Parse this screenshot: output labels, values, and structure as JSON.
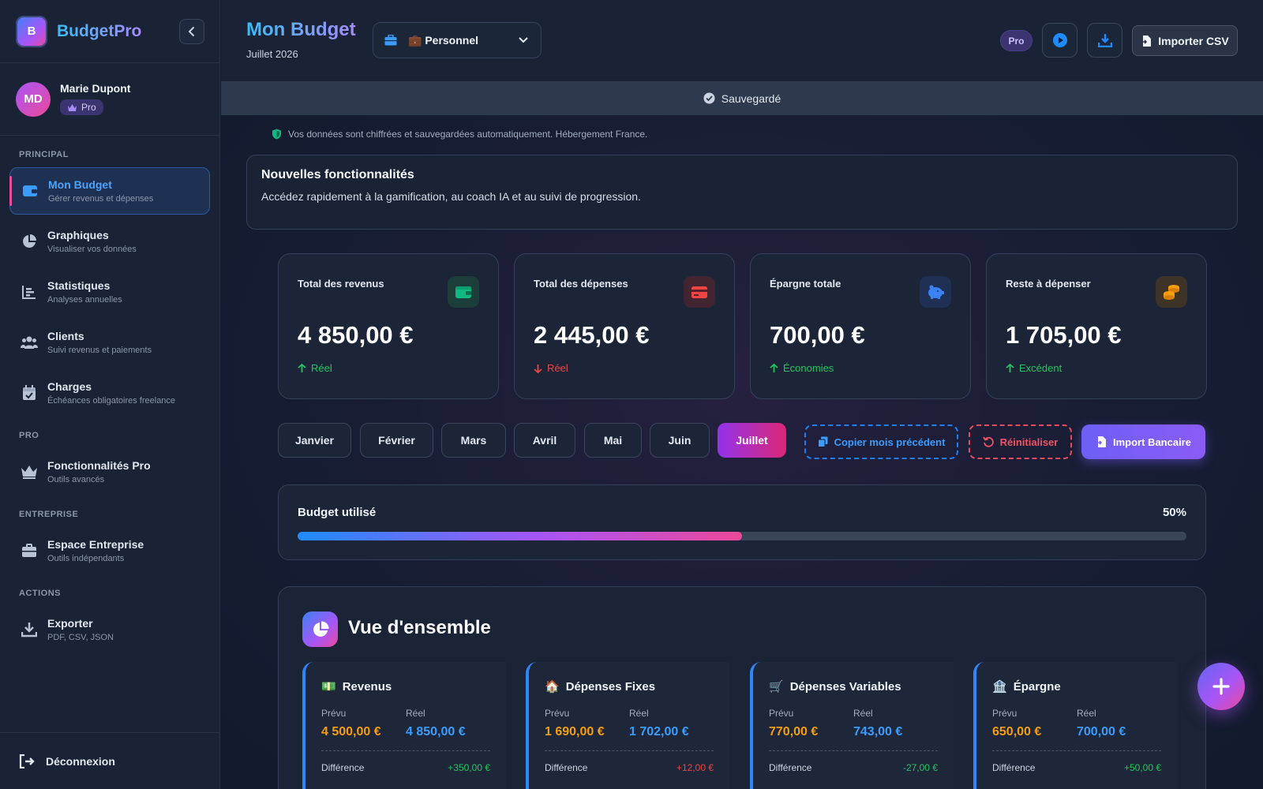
{
  "app": {
    "name": "BudgetPro",
    "logo_letter": "B"
  },
  "user": {
    "initials": "MD",
    "name": "Marie Dupont",
    "badge": "Pro"
  },
  "sidebar": {
    "sections": [
      {
        "label": "PRINCIPAL"
      },
      {
        "label": "PRO"
      },
      {
        "label": "ENTREPRISE"
      },
      {
        "label": "ACTIONS"
      }
    ],
    "items": [
      {
        "title": "Mon Budget",
        "subtitle": "Gérer revenus et dépenses",
        "icon": "wallet-icon",
        "active": true
      },
      {
        "title": "Graphiques",
        "subtitle": "Visualiser vos données",
        "icon": "pie-chart-icon"
      },
      {
        "title": "Statistiques",
        "subtitle": "Analyses annuelles",
        "icon": "bar-chart-icon"
      },
      {
        "title": "Clients",
        "subtitle": "Suivi revenus et paiements",
        "icon": "users-icon"
      },
      {
        "title": "Charges",
        "subtitle": "Échéances obligatoires freelance",
        "icon": "calendar-check-icon"
      },
      {
        "title": "Fonctionnalités Pro",
        "subtitle": "Outils avancés",
        "icon": "crown-icon"
      },
      {
        "title": "Espace Entreprise",
        "subtitle": "Outils indépendants",
        "icon": "briefcase-icon"
      },
      {
        "title": "Exporter",
        "subtitle": "PDF, CSV, JSON",
        "icon": "download-icon"
      }
    ],
    "logout_label": "Déconnexion"
  },
  "header": {
    "title": "Mon Budget",
    "date": "Juillet 2026",
    "profile_select": "💼 Personnel",
    "pro_badge": "Pro",
    "import_csv_label": "Importer CSV"
  },
  "save_status": "Sauvegardé",
  "security_note": "Vos données sont chiffrées et sauvegardées automatiquement. Hébergement France.",
  "feature_banner": {
    "title": "Nouvelles fonctionnalités",
    "description": "Accédez rapidement à la gamification, au coach IA et au suivi de progression."
  },
  "stats": [
    {
      "label": "Total des revenus",
      "value": "4 850,00 €",
      "trend": "Réel",
      "trend_dir": "up",
      "icon": "wallet-icon",
      "color": "#10b981"
    },
    {
      "label": "Total des dépenses",
      "value": "2 445,00 €",
      "trend": "Réel",
      "trend_dir": "down",
      "icon": "credit-card-icon",
      "color": "#ef4444"
    },
    {
      "label": "Épargne totale",
      "value": "700,00 €",
      "trend": "Économies",
      "trend_dir": "up",
      "icon": "piggy-bank-icon",
      "color": "#3b82f6"
    },
    {
      "label": "Reste à dépenser",
      "value": "1 705,00 €",
      "trend": "Excédent",
      "trend_dir": "up",
      "icon": "coins-icon",
      "color": "#f59e0b"
    }
  ],
  "months": [
    "Janvier",
    "Février",
    "Mars",
    "Avril",
    "Mai",
    "Juin",
    "Juillet"
  ],
  "active_month": "Juillet",
  "actions": {
    "copy_label": "Copier mois précédent",
    "reset_label": "Réinitialiser",
    "bank_import_label": "Import Bancaire"
  },
  "budget_usage": {
    "label": "Budget utilisé",
    "percent_label": "50%",
    "percent": 50
  },
  "overview": {
    "title": "Vue d'ensemble",
    "categories": [
      {
        "emoji": "💵",
        "title": "Revenus",
        "prevu_label": "Prévu",
        "reel_label": "Réel",
        "prevu": "4 500,00 €",
        "reel": "4 850,00 €",
        "diff_label": "Différence",
        "diff": "+350,00 €",
        "diff_sign": "pos"
      },
      {
        "emoji": "🏠",
        "title": "Dépenses Fixes",
        "prevu_label": "Prévu",
        "reel_label": "Réel",
        "prevu": "1 690,00 €",
        "reel": "1 702,00 €",
        "diff_label": "Différence",
        "diff": "+12,00 €",
        "diff_sign": "neg"
      },
      {
        "emoji": "🛒",
        "title": "Dépenses Variables",
        "prevu_label": "Prévu",
        "reel_label": "Réel",
        "prevu": "770,00 €",
        "reel": "743,00 €",
        "diff_label": "Différence",
        "diff": "-27,00 €",
        "diff_sign": "pos"
      },
      {
        "emoji": "🏦",
        "title": "Épargne",
        "prevu_label": "Prévu",
        "reel_label": "Réel",
        "prevu": "650,00 €",
        "reel": "700,00 €",
        "diff_label": "Différence",
        "diff": "+50,00 €",
        "diff_sign": "pos"
      }
    ]
  },
  "colors": {
    "accent": "#3b9cff",
    "pink": "#ec4899",
    "purple": "#a855f7",
    "positive": "#22c55e",
    "negative": "#ef4444",
    "warning": "#f59e0b"
  }
}
